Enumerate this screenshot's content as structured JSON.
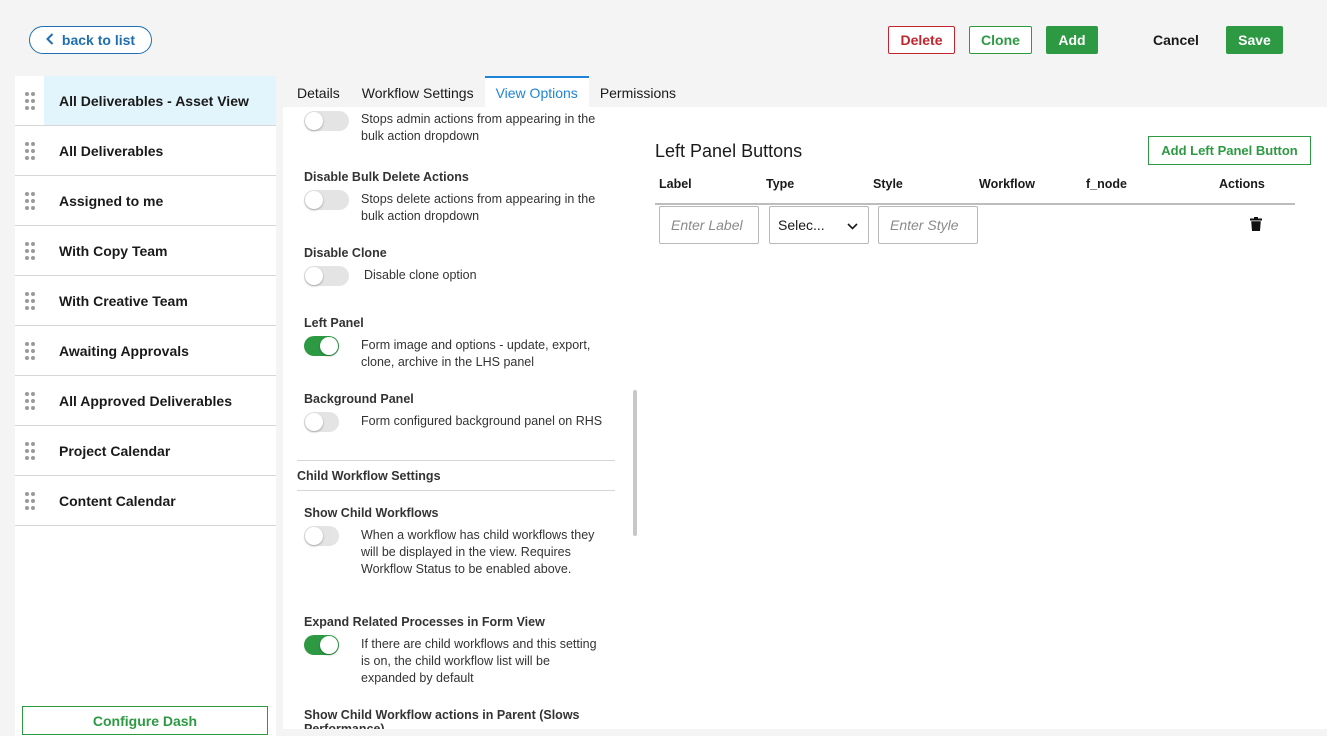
{
  "topbar": {
    "back_label": "back to list",
    "delete_label": "Delete",
    "clone_label": "Clone",
    "add_label": "Add",
    "cancel_label": "Cancel",
    "save_label": "Save"
  },
  "sidebar": {
    "items": [
      {
        "label": "All Deliverables - Asset View",
        "active": true
      },
      {
        "label": "All Deliverables"
      },
      {
        "label": "Assigned to me"
      },
      {
        "label": "With Copy Team"
      },
      {
        "label": "With Creative Team"
      },
      {
        "label": "Awaiting Approvals"
      },
      {
        "label": "All Approved Deliverables"
      },
      {
        "label": "Project Calendar"
      },
      {
        "label": "Content Calendar"
      }
    ],
    "configure_label": "Configure Dash"
  },
  "tabs": [
    {
      "label": "Details"
    },
    {
      "label": "Workflow Settings"
    },
    {
      "label": "View Options",
      "active": true
    },
    {
      "label": "Permissions"
    }
  ],
  "options": {
    "partial": {
      "desc": "Stops admin actions from appearing in the bulk action dropdown",
      "enabled": false
    },
    "disable_bulk_delete": {
      "title": "Disable Bulk Delete Actions",
      "desc": "Stops delete actions from appearing in the bulk action dropdown",
      "enabled": false
    },
    "disable_clone": {
      "title": "Disable Clone",
      "desc": "Disable clone option",
      "enabled": false
    },
    "left_panel": {
      "title": "Left Panel",
      "desc": "Form image and options - update, export, clone, archive in the LHS panel",
      "enabled": true
    },
    "background_panel": {
      "title": "Background Panel",
      "desc": "Form configured background panel on RHS",
      "enabled": false
    },
    "child_section_title": "Child Workflow Settings",
    "show_child_workflows": {
      "title": "Show Child Workflows",
      "desc": "When a workflow has child workflows they will be displayed in the view. Requires Workflow Status to be enabled above.",
      "enabled": false
    },
    "expand_related": {
      "title": "Expand Related Processes in Form View",
      "desc": "If there are child workflows and this setting is on, the child workflow list will be expanded by default",
      "enabled": true
    },
    "show_child_actions": {
      "title": "Show Child Workflow actions in Parent (Slows Performance)"
    }
  },
  "left_panel_buttons": {
    "title": "Left Panel Buttons",
    "add_label": "Add Left Panel Button",
    "columns": [
      "Label",
      "Type",
      "Style",
      "Workflow",
      "f_node",
      "Actions"
    ],
    "row": {
      "label_placeholder": "Enter Label",
      "type_value": "Selec...",
      "style_placeholder": "Enter Style"
    }
  },
  "icons": {
    "back": "chevron-left-icon",
    "drag": "drag-handle-icon",
    "select": "chevron-down-icon",
    "delete_row": "trash-icon"
  },
  "colors": {
    "accent_blue": "#1f84d6",
    "green": "#2d9a43",
    "red": "#c0262d",
    "active_row": "#e2f4fc"
  }
}
